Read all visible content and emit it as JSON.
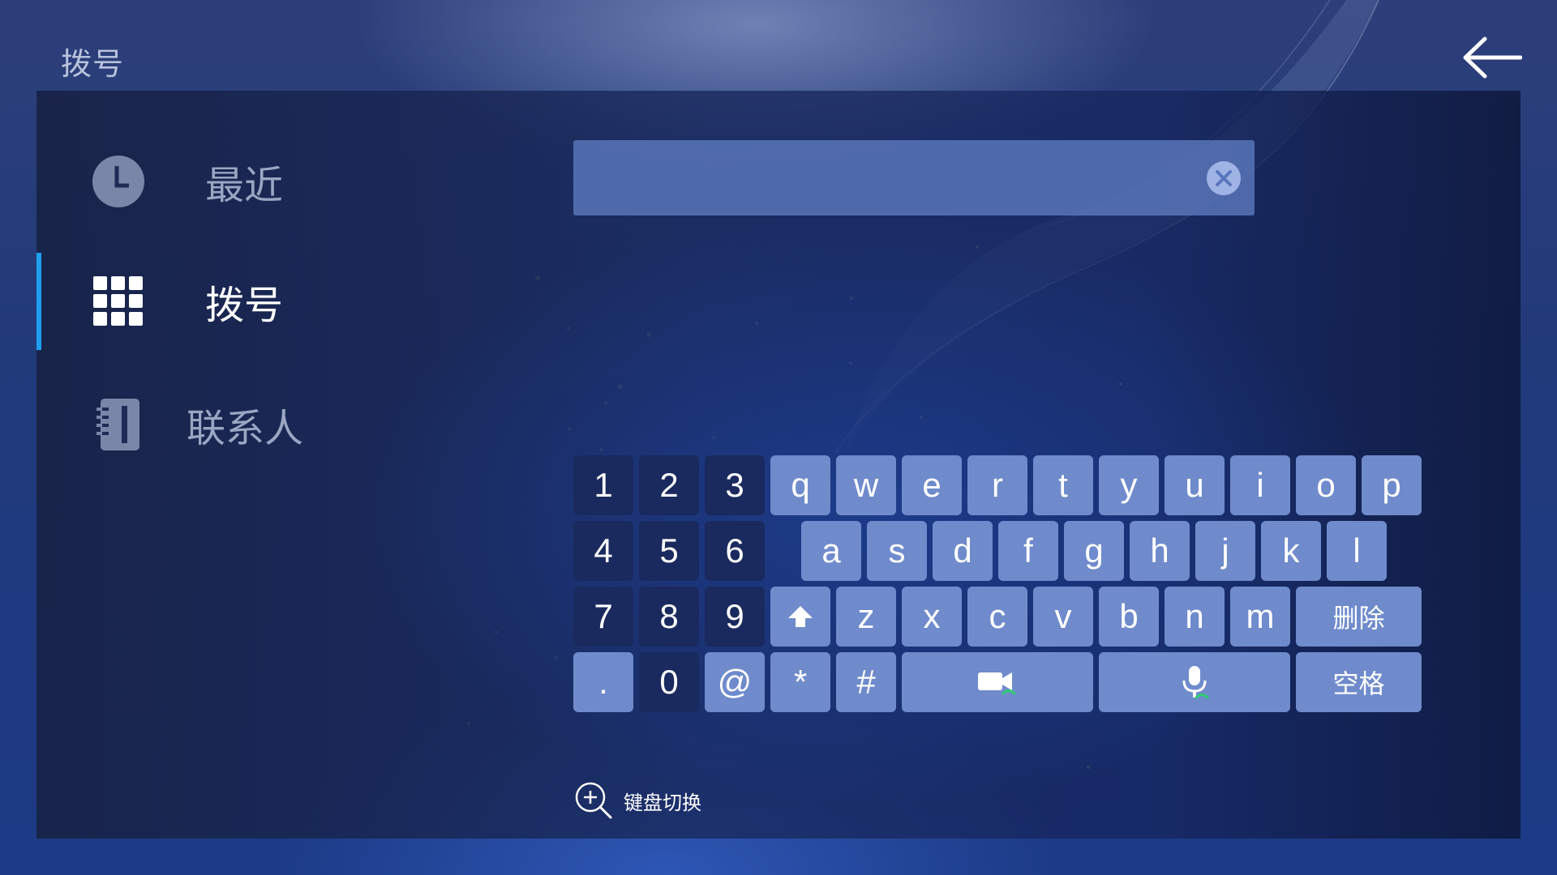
{
  "header": {
    "title": "拨号",
    "back_icon": "back-arrow-icon"
  },
  "sidebar": {
    "items": [
      {
        "label": "最近",
        "icon": "clock-icon",
        "active": false
      },
      {
        "label": "拨号",
        "icon": "dialpad-icon",
        "active": true
      },
      {
        "label": "联系人",
        "icon": "contacts-book-icon",
        "active": false
      }
    ]
  },
  "dial_input": {
    "value": "",
    "clear_icon": "clear-icon"
  },
  "keyboard": {
    "numpad": [
      [
        "1",
        "2",
        "3"
      ],
      [
        "4",
        "5",
        "6"
      ],
      [
        "7",
        "8",
        "9"
      ],
      [
        ".",
        "0",
        "@"
      ]
    ],
    "row1": [
      "q",
      "w",
      "e",
      "r",
      "t",
      "y",
      "u",
      "i",
      "o",
      "p"
    ],
    "row2": [
      "a",
      "s",
      "d",
      "f",
      "g",
      "h",
      "j",
      "k",
      "l"
    ],
    "row3": [
      "z",
      "x",
      "c",
      "v",
      "b",
      "n",
      "m"
    ],
    "shift_icon": "shift-icon",
    "delete_label": "删除",
    "star": "*",
    "hash": "#",
    "video_call_icon": "video-call-icon",
    "voice_call_icon": "voice-call-icon",
    "space_label": "空格"
  },
  "keyboard_switch": {
    "label": "键盘切换",
    "icon": "zoom-plus-icon"
  },
  "colors": {
    "accent": "#1e9ff0",
    "key_light": "#6f8bcc",
    "key_dark": "#1a2a5e",
    "call_green": "#2ecc71"
  }
}
